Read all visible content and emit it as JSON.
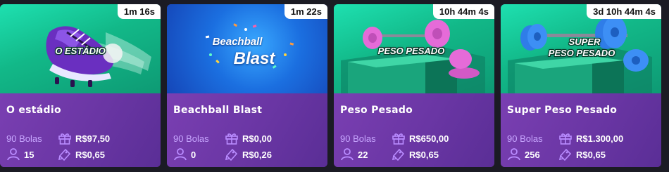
{
  "colors": {
    "page_background": "#1b1b24",
    "info_panel": "#6f3aa8",
    "balls_text": "#c8a7ff",
    "icon_accent": "#b98cff",
    "timer_background": "#ffffff"
  },
  "cards": [
    {
      "timer": "1m 16s",
      "banner_title": "O ESTÁDIO",
      "title": "O estádio",
      "balls": "90 Bolas",
      "prize": "R$97,50",
      "players": "15",
      "price": "R$0,65",
      "icons": {
        "prize": "gift-icon",
        "players": "user-icon",
        "price": "ticket-icon"
      }
    },
    {
      "timer": "1m 22s",
      "banner_title_line1": "Beachball",
      "banner_title_line2": "Blast",
      "title": "Beachball Blast",
      "balls": "90 Bolas",
      "prize": "R$0,00",
      "players": "0",
      "price": "R$0,26",
      "icons": {
        "prize": "gift-icon",
        "players": "user-icon",
        "price": "ticket-icon"
      }
    },
    {
      "timer": "10h 44m 4s",
      "banner_title": "PESO PESADO",
      "title": "Peso Pesado",
      "balls": "90 Bolas",
      "prize": "R$650,00",
      "players": "22",
      "price": "R$0,65",
      "icons": {
        "prize": "gift-icon",
        "players": "user-icon",
        "price": "ticket-icon"
      }
    },
    {
      "timer": "3d 10h 44m 4s",
      "banner_title_line1": "SUPER",
      "banner_title_line2": "PESO PESADO",
      "title": "Super Peso Pesado",
      "balls": "90 Bolas",
      "prize": "R$1.300,00",
      "players": "256",
      "price": "R$0,65",
      "icons": {
        "prize": "gift-icon",
        "players": "user-icon",
        "price": "ticket-icon"
      }
    }
  ]
}
